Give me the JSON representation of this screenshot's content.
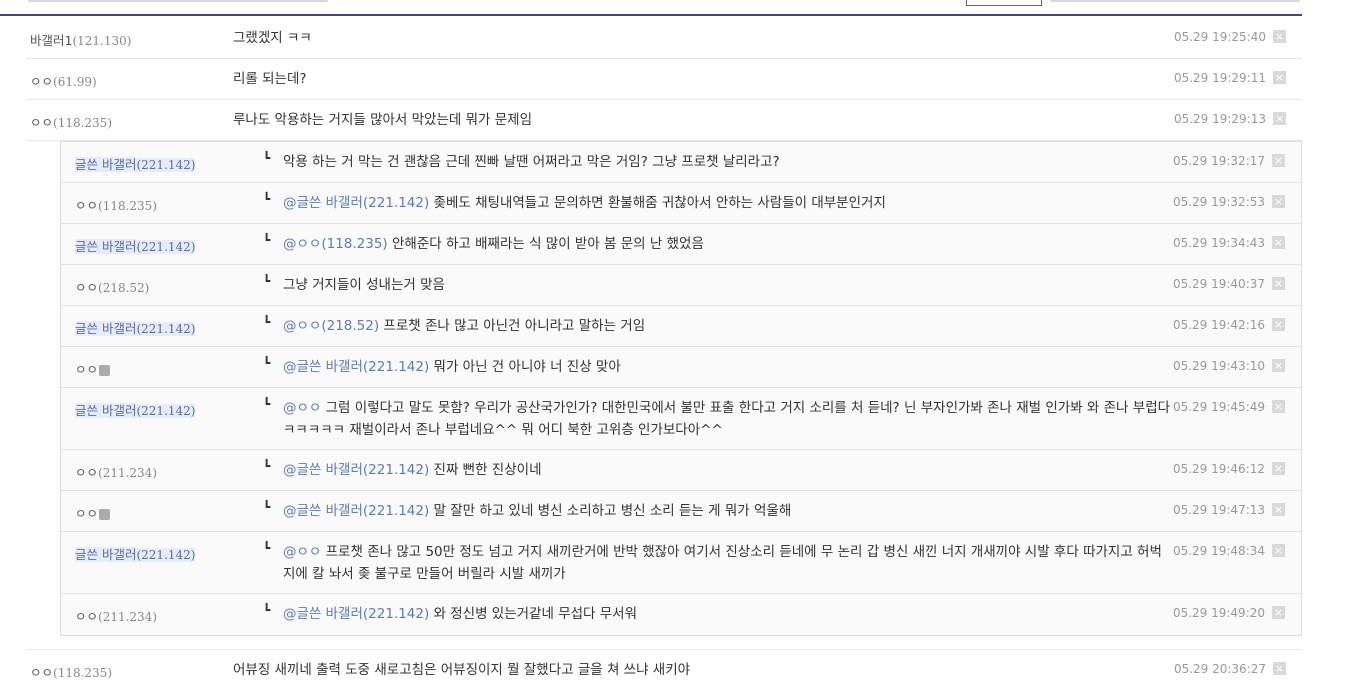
{
  "top_comments": [
    {
      "nick": "바갤러1",
      "ip": "(121.130)",
      "writer": false,
      "text": "그랬겠지 ㅋㅋ",
      "date": "05.29 19:25:40"
    },
    {
      "nick": "ㅇㅇ",
      "ip": "(61.99)",
      "writer": false,
      "text": "리롤 되는데?",
      "date": "05.29 19:29:11"
    },
    {
      "nick": "ㅇㅇ",
      "ip": "(118.235)",
      "writer": false,
      "text": "루나도 악용하는 거지들 많아서 막았는데 뭐가 문제임",
      "date": "05.29 19:29:13"
    }
  ],
  "replies": [
    {
      "nick": "글쓴 바갤러",
      "ip": "(221.142)",
      "writer": true,
      "memo": false,
      "mention": "",
      "text": "악용 하는 거 막는 건 괜찮음 근데 찐빠 날땐 어쩌라고 막은 거임? 그냥 프로챗 날리라고?",
      "date": "05.29 19:32:17"
    },
    {
      "nick": "ㅇㅇ",
      "ip": "(118.235)",
      "writer": false,
      "memo": false,
      "mention": "@글쓴 바갤러(221.142)",
      "text": "좆베도 채팅내역들고 문의하면 환불해줌 귀찮아서 안하는 사람들이 대부분인거지",
      "date": "05.29 19:32:53"
    },
    {
      "nick": "글쓴 바갤러",
      "ip": "(221.142)",
      "writer": true,
      "memo": false,
      "mention": "@ㅇㅇ(118.235)",
      "text": "안해준다 하고 배째라는 식 많이 받아 봄 문의 난 했었음",
      "date": "05.29 19:34:43"
    },
    {
      "nick": "ㅇㅇ",
      "ip": "(218.52)",
      "writer": false,
      "memo": false,
      "mention": "",
      "text": "그냥 거지들이 성내는거 맞음",
      "date": "05.29 19:40:37"
    },
    {
      "nick": "글쓴 바갤러",
      "ip": "(221.142)",
      "writer": true,
      "memo": false,
      "mention": "@ㅇㅇ(218.52)",
      "text": "프로챗 존나 많고 아닌건 아니라고 말하는 거임",
      "date": "05.29 19:42:16"
    },
    {
      "nick": "ㅇㅇ",
      "ip": "",
      "writer": false,
      "memo": true,
      "mention": "@글쓴 바갤러(221.142)",
      "text": "뭐가 아닌 건 아니야 너 진상 맞아",
      "date": "05.29 19:43:10"
    },
    {
      "nick": "글쓴 바갤러",
      "ip": "(221.142)",
      "writer": true,
      "memo": false,
      "mention": "@ㅇㅇ",
      "text": "그럼 이렇다고 말도 못함? 우리가 공산국가인가? 대한민국에서 불만 표출 한다고 거지 소리를 처 듣네? 닌 부자인가봐 존나 재벌 인가봐 와 존나 부럽다 ㅋㅋㅋㅋㅋ 재벌이라서 존나 부럽네요^^ 뭐 어디 북한 고위층 인가보다아^^",
      "date": "05.29 19:45:49"
    },
    {
      "nick": "ㅇㅇ",
      "ip": "(211.234)",
      "writer": false,
      "memo": false,
      "mention": "@글쓴 바갤러(221.142)",
      "text": "진짜 뻔한 진상이네",
      "date": "05.29 19:46:12"
    },
    {
      "nick": "ㅇㅇ",
      "ip": "",
      "writer": false,
      "memo": true,
      "mention": "@글쓴 바갤러(221.142)",
      "text": "말 잘만 하고 있네 병신 소리하고 병신 소리 듣는 게 뭐가 억울해",
      "date": "05.29 19:47:13"
    },
    {
      "nick": "글쓴 바갤러",
      "ip": "(221.142)",
      "writer": true,
      "memo": false,
      "mention": "@ㅇㅇ",
      "text": "프로챗 존나 많고 50만 정도 넘고 거지 새끼란거에 반박 했잖아 여기서 진상소리 듣네에 무 논리 갑 병신 새낀 너지 개새끼야 시발 후다 따가지고 허벅지에 칼 놔서 좆 불구로 만들어 버릴라 시발 새끼가",
      "date": "05.29 19:48:34"
    },
    {
      "nick": "ㅇㅇ",
      "ip": "(211.234)",
      "writer": false,
      "memo": false,
      "mention": "@글쓴 바갤러(221.142)",
      "text": "와 정신병 있는거같네 무섭다 무서워",
      "date": "05.29 19:49:20"
    }
  ],
  "bottom_comments": [
    {
      "nick": "ㅇㅇ",
      "ip": "(118.235)",
      "writer": false,
      "text": "어뷰징 새끼네 출력 도중 새로고침은 어뷰징이지 뭘 잘했다고 글을 쳐 쓰냐 새키야",
      "date": "05.29 20:36:27"
    }
  ],
  "icons": {
    "delete": "close-icon",
    "reply_arrow": "reply-arrow-icon",
    "memo": "memo-icon"
  },
  "colors": {
    "writer_bg": "#e6ecf9",
    "mention": "#5b7ac7",
    "border_accent": "#3b4890"
  }
}
